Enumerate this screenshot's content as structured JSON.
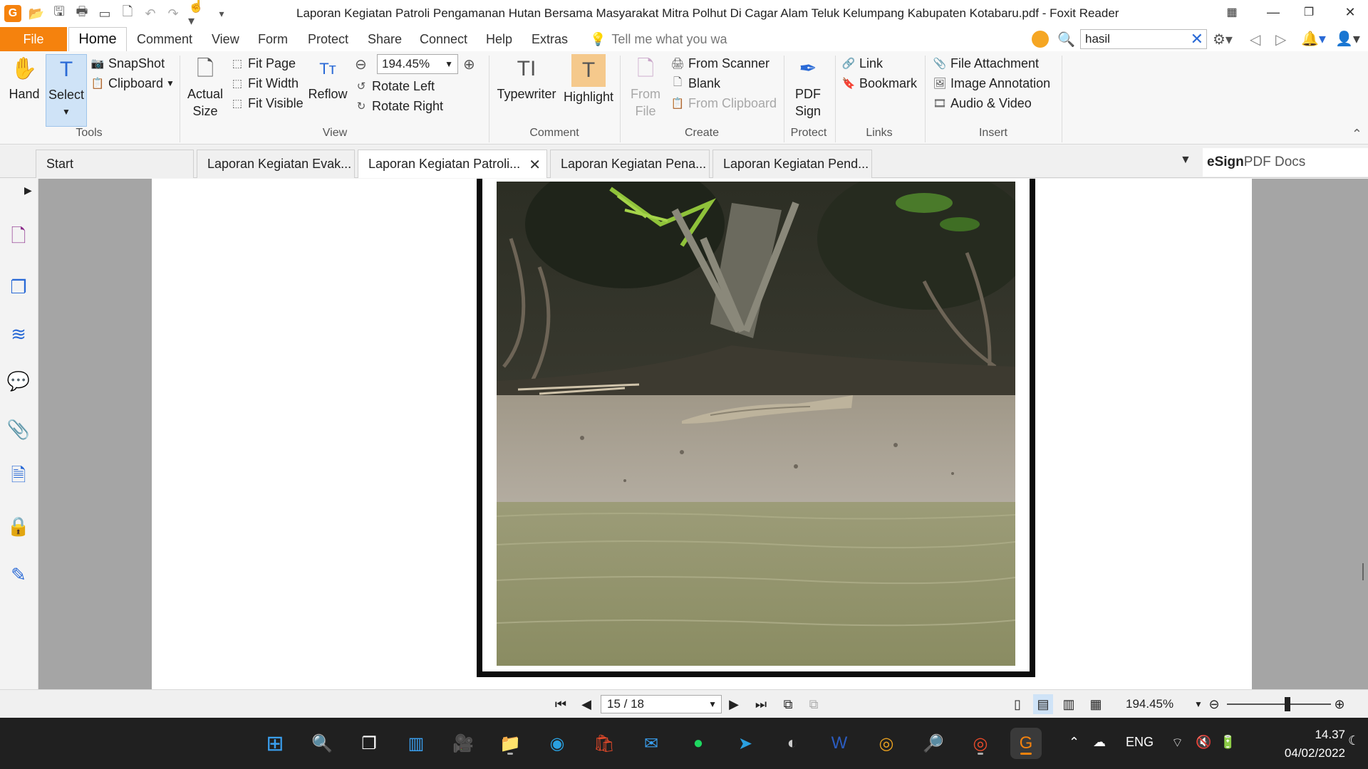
{
  "window": {
    "title": "Laporan Kegiatan Patroli Pengamanan Hutan Bersama Masyarakat Mitra Polhut Di Cagar Alam Teluk Kelumpang Kabupaten Kotabaru.pdf - Foxit Reader",
    "logo_letter": "G"
  },
  "menu": {
    "file": "File",
    "tabs": [
      "Home",
      "Comment",
      "View",
      "Form",
      "Protect",
      "Share",
      "Connect",
      "Help",
      "Extras"
    ],
    "tell_me": "Tell me what you wa",
    "search_value": "hasil"
  },
  "ribbon": {
    "tools": {
      "hand": "Hand",
      "select": "Select",
      "snapshot": "SnapShot",
      "clipboard": "Clipboard",
      "label": "Tools"
    },
    "view": {
      "actual_size_1": "Actual",
      "actual_size_2": "Size",
      "fit_page": "Fit Page",
      "fit_width": "Fit Width",
      "fit_visible": "Fit Visible",
      "reflow": "Reflow",
      "zoom": "194.45%",
      "rotate_left": "Rotate Left",
      "rotate_right": "Rotate Right",
      "label": "View"
    },
    "comment": {
      "typewriter": "Typewriter",
      "highlight": "Highlight",
      "label": "Comment"
    },
    "create": {
      "from_file_1": "From",
      "from_file_2": "File",
      "from_scanner": "From Scanner",
      "blank": "Blank",
      "from_clipboard": "From Clipboard",
      "label": "Create"
    },
    "protect": {
      "pdf_sign_1": "PDF",
      "pdf_sign_2": "Sign",
      "label": "Protect"
    },
    "links": {
      "link": "Link",
      "bookmark": "Bookmark",
      "label": "Links"
    },
    "insert": {
      "file_attachment": "File Attachment",
      "image_annotation": "Image Annotation",
      "audio_video": "Audio & Video",
      "label": "Insert"
    }
  },
  "doc_tabs": [
    "Start",
    "Laporan Kegiatan Evak...",
    "Laporan Kegiatan Patroli...",
    "Laporan Kegiatan Pena...",
    "Laporan Kegiatan Pend..."
  ],
  "esign": {
    "bold": "eSign",
    "rest": " PDF Docs"
  },
  "status": {
    "page": "15 / 18",
    "zoom": "194.45%",
    "zoom_slider_level": 0.58
  },
  "taskbar": {
    "lang": "ENG",
    "time": "14.37",
    "date": "04/02/2022"
  }
}
